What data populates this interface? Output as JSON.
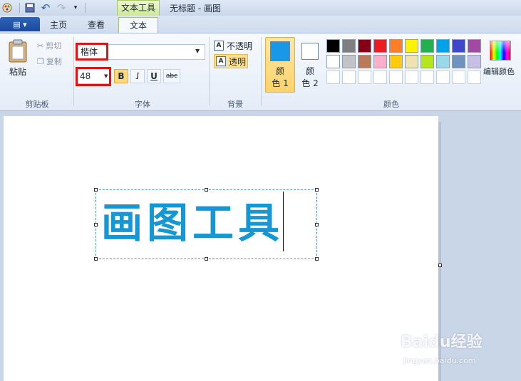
{
  "window": {
    "title": "无标题 - 画图",
    "context_tab": "文本工具"
  },
  "tabs": {
    "home": "主页",
    "view": "查看",
    "text": "文本"
  },
  "clipboard": {
    "paste": "粘贴",
    "cut": "剪切",
    "copy": "复制",
    "group_label": "剪贴板"
  },
  "font": {
    "family": "楷体",
    "size": "48",
    "bold": "B",
    "italic": "I",
    "underline": "U",
    "strike": "abc",
    "group_label": "字体"
  },
  "background": {
    "opaque": "不透明",
    "transparent": "透明",
    "group_label": "背景"
  },
  "colors": {
    "color1_label_a": "颜",
    "color1_label_b": "色 1",
    "color2_label_a": "颜",
    "color2_label_b": "色 2",
    "edit_colors": "编辑颜色",
    "group_label": "颜色",
    "color1": "#1a98e8",
    "color2": "#ffffff",
    "palette_row1": [
      "#000000",
      "#7f7f7f",
      "#880015",
      "#ed1c24",
      "#ff7f27",
      "#fff200",
      "#22b14c",
      "#00a2e8",
      "#3f48cc",
      "#a349a4"
    ],
    "palette_row2": [
      "#ffffff",
      "#c3c3c3",
      "#b97a57",
      "#ffaec9",
      "#ffc90e",
      "#efe4b0",
      "#b5e61d",
      "#99d9ea",
      "#7092be",
      "#c8bfe7"
    ],
    "palette_row3": [
      "#ffffff",
      "#ffffff",
      "#ffffff",
      "#ffffff",
      "#ffffff",
      "#ffffff",
      "#ffffff",
      "#ffffff",
      "#ffffff",
      "#ffffff"
    ]
  },
  "canvas": {
    "text": "画图工具"
  },
  "watermark": {
    "main": "Baidu经验",
    "sub": "jingyan.baidu.com"
  },
  "icons": [
    "paint-app-icon",
    "save-icon",
    "undo-icon",
    "redo-icon",
    "customize-qa-icon",
    "paste-icon",
    "cut-icon",
    "copy-icon",
    "edit-colors-icon"
  ]
}
